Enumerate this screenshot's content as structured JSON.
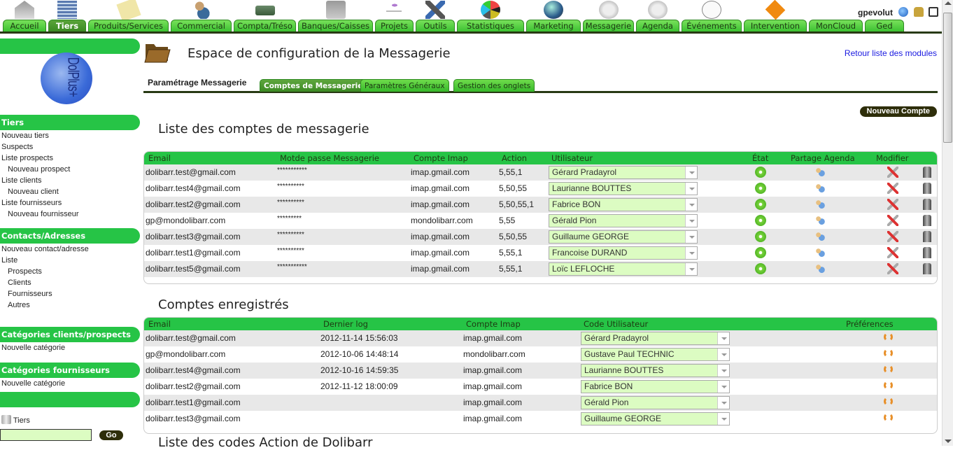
{
  "topbar": {
    "tabs": [
      {
        "label": "Accueil",
        "icon": "home-icon",
        "active": false
      },
      {
        "label": "Tiers",
        "icon": "building-icon",
        "active": true
      },
      {
        "label": "Produits/Services",
        "icon": "box-icon",
        "active": false
      },
      {
        "label": "Commercial",
        "icon": "users-icon",
        "active": false
      },
      {
        "label": "Compta/Tréso",
        "icon": "money-icon",
        "active": false
      },
      {
        "label": "Banques/Caisses",
        "icon": "safe-icon",
        "active": false
      },
      {
        "label": "Projets",
        "icon": "hierarchy-icon",
        "active": false
      },
      {
        "label": "Outils",
        "icon": "tools-icon",
        "active": false
      },
      {
        "label": "Statistiques",
        "icon": "pie-chart-icon",
        "active": false
      },
      {
        "label": "Marketing",
        "icon": "globe-at-icon",
        "active": false
      },
      {
        "label": "Messagerie",
        "icon": "mail-clock-icon",
        "active": false
      },
      {
        "label": "Agenda",
        "icon": "agenda-clock-icon",
        "active": false
      },
      {
        "label": "Événements",
        "icon": "clock-icon",
        "active": false
      },
      {
        "label": "Intervention",
        "icon": "roadwork-icon",
        "active": false
      },
      {
        "label": "MonCloud",
        "icon": "cloud-icon",
        "active": false
      },
      {
        "label": "Ged",
        "icon": "document-icon",
        "active": false
      }
    ],
    "user": "gpevolut"
  },
  "sidebar": {
    "sections": [
      {
        "title": "",
        "items": []
      },
      {
        "title": "Tiers",
        "items": [
          {
            "label": "Nouveau tiers",
            "sub": false
          },
          {
            "label": "Suspects",
            "sub": false
          },
          {
            "label": "Liste prospects",
            "sub": false
          },
          {
            "label": "Nouveau prospect",
            "sub": true
          },
          {
            "label": "Liste clients",
            "sub": false
          },
          {
            "label": "Nouveau client",
            "sub": true
          },
          {
            "label": "Liste fournisseurs",
            "sub": false
          },
          {
            "label": "Nouveau fournisseur",
            "sub": true
          }
        ]
      },
      {
        "title": "Contacts/Adresses",
        "items": [
          {
            "label": "Nouveau contact/adresse",
            "sub": false
          },
          {
            "label": "Liste",
            "sub": false
          },
          {
            "label": "Prospects",
            "sub": true
          },
          {
            "label": "Clients",
            "sub": true
          },
          {
            "label": "Fournisseurs",
            "sub": true
          },
          {
            "label": "Autres",
            "sub": true
          }
        ]
      },
      {
        "title": "Catégories clients/prospects",
        "items": [
          {
            "label": "Nouvelle catégorie",
            "sub": false
          }
        ]
      },
      {
        "title": "Catégories fournisseurs",
        "items": [
          {
            "label": "Nouvelle catégorie",
            "sub": false
          }
        ]
      }
    ],
    "logo_text": "DolPlus+",
    "search": {
      "label": "Tiers",
      "value": "",
      "go": "Go"
    }
  },
  "main": {
    "title": "Espace de configuration de la Messagerie",
    "back_link": "Retour liste des modules",
    "subtabs_label": "Paramétrage Messagerie",
    "subtabs": [
      {
        "label": "Comptes de Messagerie",
        "active": true
      },
      {
        "label": "Paramètres Généraux",
        "active": false
      },
      {
        "label": "Gestion des onglets",
        "active": false
      }
    ],
    "new_account": "Nouveau Compte",
    "accounts": {
      "title": "Liste des comptes de messagerie",
      "headers": [
        "Email",
        "Motde passe Messagerie",
        "Compte Imap",
        "Action",
        "Utilisateur",
        "État",
        "Partage Agenda",
        "Modifier"
      ],
      "rows": [
        {
          "email": "dolibarr.test@gmail.com",
          "password": "***********",
          "imap": "imap.gmail.com",
          "action": "5,55,1",
          "user": "Gérard Pradayrol"
        },
        {
          "email": "dolibarr.test4@gmail.com",
          "password": "**********",
          "imap": "imap.gmail.com",
          "action": "5,50,55",
          "user": "Laurianne BOUTTES"
        },
        {
          "email": "dolibarr.test2@gmail.com",
          "password": "**********",
          "imap": "imap.gmail.com",
          "action": "5,50,55,1",
          "user": "Fabrice BON"
        },
        {
          "email": "gp@mondolibarr.com",
          "password": "*********",
          "imap": "mondolibarr.com",
          "action": "5,55",
          "user": "Gérald Pion"
        },
        {
          "email": "dolibarr.test3@gmail.com",
          "password": "**********",
          "imap": "imap.gmail.com",
          "action": "5,50,55",
          "user": "Guillaume GEORGE"
        },
        {
          "email": "dolibarr.test1@gmail.com",
          "password": "**********",
          "imap": "imap.gmail.com",
          "action": "5,55,1",
          "user": "Francoise DURAND"
        },
        {
          "email": "dolibarr.test5@gmail.com",
          "password": "***********",
          "imap": "imap.gmail.com",
          "action": "5,55,1",
          "user": "Loïc LEFLOCHE"
        }
      ]
    },
    "registered": {
      "title": "Comptes enregistrés",
      "headers": [
        "Email",
        "Dernier log",
        "Compte Imap",
        "Code Utilisateur",
        "Préférences"
      ],
      "rows": [
        {
          "email": "dolibarr.test@gmail.com",
          "last_log": "2012-11-14 15:56:03",
          "imap": "imap.gmail.com",
          "user": "Gérard Pradayrol"
        },
        {
          "email": "gp@mondolibarr.com",
          "last_log": "2012-10-06 14:48:14",
          "imap": "mondolibarr.com",
          "user": "Gustave Paul TECHNIC"
        },
        {
          "email": "dolibarr.test4@gmail.com",
          "last_log": "2012-10-16 14:59:35",
          "imap": "imap.gmail.com",
          "user": "Laurianne BOUTTES"
        },
        {
          "email": "dolibarr.test2@gmail.com",
          "last_log": "2012-11-12 18:00:09",
          "imap": "imap.gmail.com",
          "user": "Fabrice BON"
        },
        {
          "email": "dolibarr.test1@gmail.com",
          "last_log": "",
          "imap": "imap.gmail.com",
          "user": "Gérald Pion"
        },
        {
          "email": "dolibarr.test3@gmail.com",
          "last_log": "",
          "imap": "imap.gmail.com",
          "user": "Guillaume GEORGE"
        }
      ]
    },
    "codes_title": "Liste des codes Action de Dolibarr"
  },
  "colors": {
    "green": "#26c446",
    "dark": "#283a14",
    "link": "#1a1ae0",
    "select_bg": "#dcfcc2"
  }
}
